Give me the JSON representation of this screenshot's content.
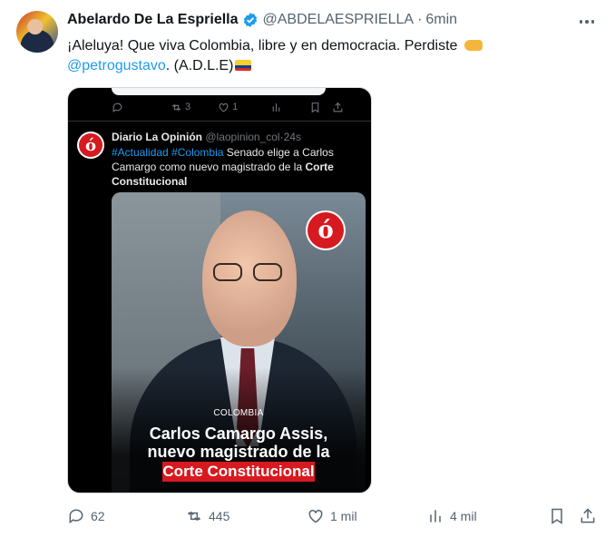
{
  "author": {
    "name": "Abelardo De La Espriella",
    "handle": "@ABDELAESPRIELLA",
    "separator": "·",
    "time": "6min"
  },
  "tweet": {
    "text_1": "¡Aleluya! Que viva Colombia, libre y en democracia. Perdiste",
    "mention": "@petrogustavo",
    "text_2": ". (A.D.L.E)",
    "emoji_icons": [
      "fist-emoji-icon",
      "colombia-flag-icon"
    ]
  },
  "quoted": {
    "prev_retweets": "3",
    "prev_likes": "1",
    "name": "Diario La Opinión",
    "handle": "@laopinion_col",
    "separator": "·",
    "time": "24s",
    "hashtag_1": "#Actualidad",
    "hashtag_2": "#Colombia",
    "text": " Senado elige a Carlos Camargo como nuevo magistrado de la ",
    "text_bold": "Corte Constitucional",
    "logo_glyph": "ó",
    "image": {
      "section": "COLOMBIA",
      "headline_1": "Carlos Camargo Assis,",
      "headline_2": "nuevo magistrado de la",
      "headline_3": "Corte Constitucional"
    }
  },
  "actions": {
    "replies": "62",
    "retweets": "445",
    "likes": "1 mil",
    "views": "4 mil"
  },
  "colors": {
    "accent": "#1d9bf0",
    "muted": "#536471",
    "brand_red": "#d71920"
  }
}
